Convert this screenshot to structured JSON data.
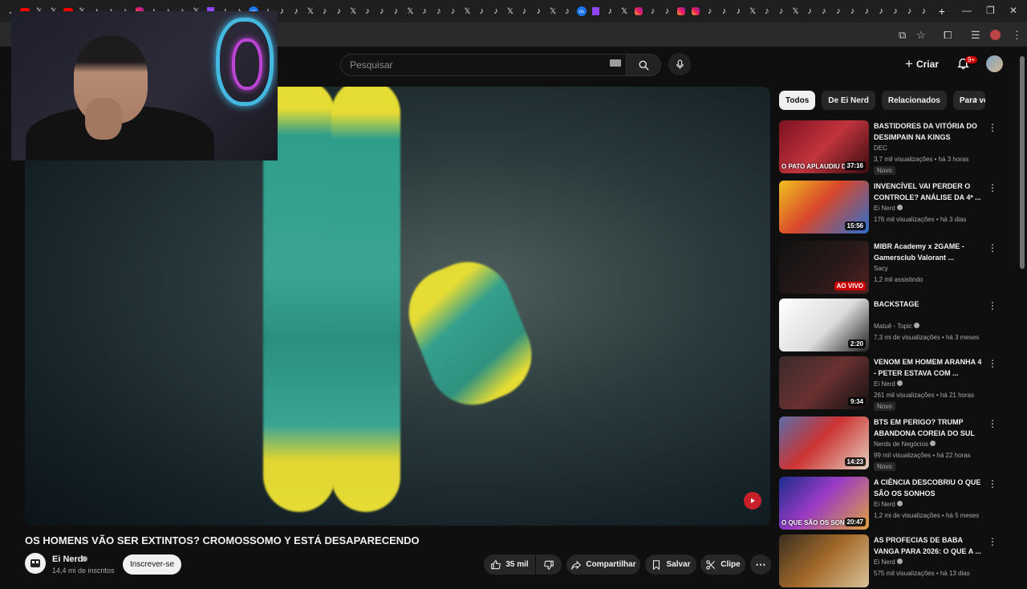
{
  "browser": {
    "tab_icons": [
      "yt",
      "x",
      "x",
      "yt",
      "x",
      "tiktok",
      "tiktok",
      "tiktok",
      "insta",
      "tiktok",
      "tiktok",
      "tiktok",
      "x",
      "twitch",
      "tiktok",
      "tiktok",
      "meta",
      "tiktok",
      "tiktok",
      "tiktok",
      "x",
      "tiktok",
      "tiktok",
      "x",
      "tiktok",
      "tiktok",
      "tiktok",
      "x",
      "tiktok",
      "tiktok",
      "tiktok",
      "x",
      "tiktok",
      "tiktok",
      "x",
      "tiktok",
      "tiktok",
      "x",
      "tiktok",
      "meta",
      "twitch",
      "tiktok",
      "x",
      "insta",
      "tiktok",
      "tiktok",
      "insta",
      "insta",
      "tiktok",
      "tiktok",
      "tiktok",
      "x",
      "tiktok",
      "tiktok",
      "x",
      "tiktok",
      "tiktok",
      "tiktok",
      "tiktok",
      "tiktok",
      "tiktok",
      "tiktok",
      "tiktok",
      "tiktok"
    ],
    "new_tab_label": "+"
  },
  "header": {
    "search_placeholder": "Pesquisar",
    "create_label": "Criar",
    "notification_count": "9+"
  },
  "video": {
    "title": "OS HOMENS VÃO SER EXTINTOS? CROMOSSOMO Y ESTÁ DESAPARECENDO",
    "channel": "Ei Nerd",
    "subscribers": "14,4 mi de inscritos",
    "subscribe_label": "Inscrever-se",
    "likes": "35 mil",
    "share_label": "Compartilhar",
    "save_label": "Salvar",
    "clip_label": "Clipe"
  },
  "chips": [
    "Todos",
    "De Ei Nerd",
    "Relacionados",
    "Para você"
  ],
  "recommendations": [
    {
      "title": "BASTIDORES DA VITÓRIA DO DESIMPAIN NA KINGS LEAGU...",
      "channel": "DEC",
      "meta": "3,7 mil visualizações • há 3 horas",
      "badge": "Novo",
      "duration": "37:16",
      "live": false,
      "verified": false,
      "thumb_caption": "O PATO APLAUDIU DE PÉ!"
    },
    {
      "title": "INVENCÍVEL VAI PERDER O CONTROLE? ANÁLISE DA 4ª ...",
      "channel": "Ei Nerd",
      "meta": "176 mil visualizações • há 3 dias",
      "badge": "",
      "duration": "15:56",
      "live": false,
      "verified": true,
      "thumb_caption": ""
    },
    {
      "title": "MIBR Academy x 2GAME - Gamersclub Valorant ...",
      "channel": "Sacy",
      "meta": "1,2 mil assistindo",
      "badge": "",
      "duration": "AO VIVO",
      "live": true,
      "verified": false,
      "thumb_caption": ""
    },
    {
      "title": "BACKSTAGE",
      "channel": "Matuê - Topic",
      "meta": "7,3 mi de visualizações • há 3 meses",
      "badge": "",
      "duration": "2:20",
      "live": false,
      "verified": true,
      "thumb_caption": ""
    },
    {
      "title": "VENOM EM HOMEM ARANHA 4 - PETER ESTAVA COM ...",
      "channel": "Ei Nerd",
      "meta": "261 mil visualizações • há 21 horas",
      "badge": "Novo",
      "duration": "9:34",
      "live": false,
      "verified": true,
      "thumb_caption": ""
    },
    {
      "title": "BTS EM PERIGO? TRUMP ABANDONA COREIA DO SUL",
      "channel": "Nerds de Negócios",
      "meta": "99 mil visualizações • há 22 horas",
      "badge": "Novo",
      "duration": "14:23",
      "live": false,
      "verified": true,
      "thumb_caption": ""
    },
    {
      "title": "A CIÊNCIA DESCOBRIU O QUE SÃO OS SONHOS",
      "channel": "Ei Nerd",
      "meta": "1,2 mi de visualizações • há 5 meses",
      "badge": "",
      "duration": "20:47",
      "live": false,
      "verified": true,
      "thumb_caption": "O QUE SÃO OS SONHOS?"
    },
    {
      "title": "AS PROFECIAS DE BABA VANGA PARA 2026: O QUE A ...",
      "channel": "Ei Nerd",
      "meta": "575 mil visualizações • há 13 dias",
      "badge": "",
      "duration": "",
      "live": false,
      "verified": true,
      "thumb_caption": ""
    }
  ],
  "colors": {
    "accent_red": "#cc0000",
    "background": "#0f0f0f",
    "chip_bg": "#272727"
  }
}
